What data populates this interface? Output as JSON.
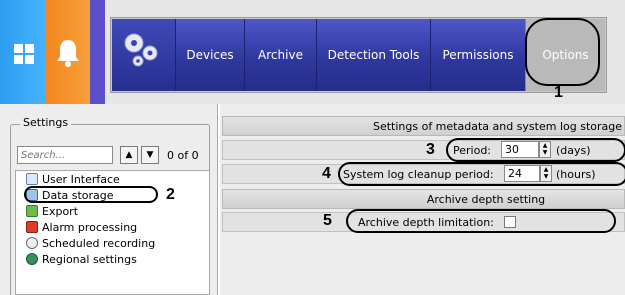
{
  "nav": {
    "items": [
      "Devices",
      "Archive",
      "Detection Tools",
      "Permissions",
      "Options"
    ]
  },
  "sidebar": {
    "title": "Settings",
    "search_placeholder": "Search...",
    "count": "0 of 0",
    "tree": [
      "User Interface",
      "Data storage",
      "Export",
      "Alarm processing",
      "Scheduled recording",
      "Regional settings"
    ]
  },
  "main": {
    "meta_section": "Settings of metadata and system log storage",
    "period_label": "Period:",
    "period_value": "30",
    "period_unit": "(days)",
    "cleanup_label": "System log cleanup period:",
    "cleanup_value": "24",
    "cleanup_unit": "(hours)",
    "archive_section": "Archive depth setting",
    "depth_label": "Archive depth limitation:",
    "depth_checked": false
  },
  "callouts": [
    "1",
    "2",
    "3",
    "4",
    "5"
  ],
  "colors": {
    "windows_tile": "#2d9df0",
    "bell_tile": "#f2861f",
    "nav_blue": "#2f389e",
    "options_active": "#b9b9b9"
  }
}
